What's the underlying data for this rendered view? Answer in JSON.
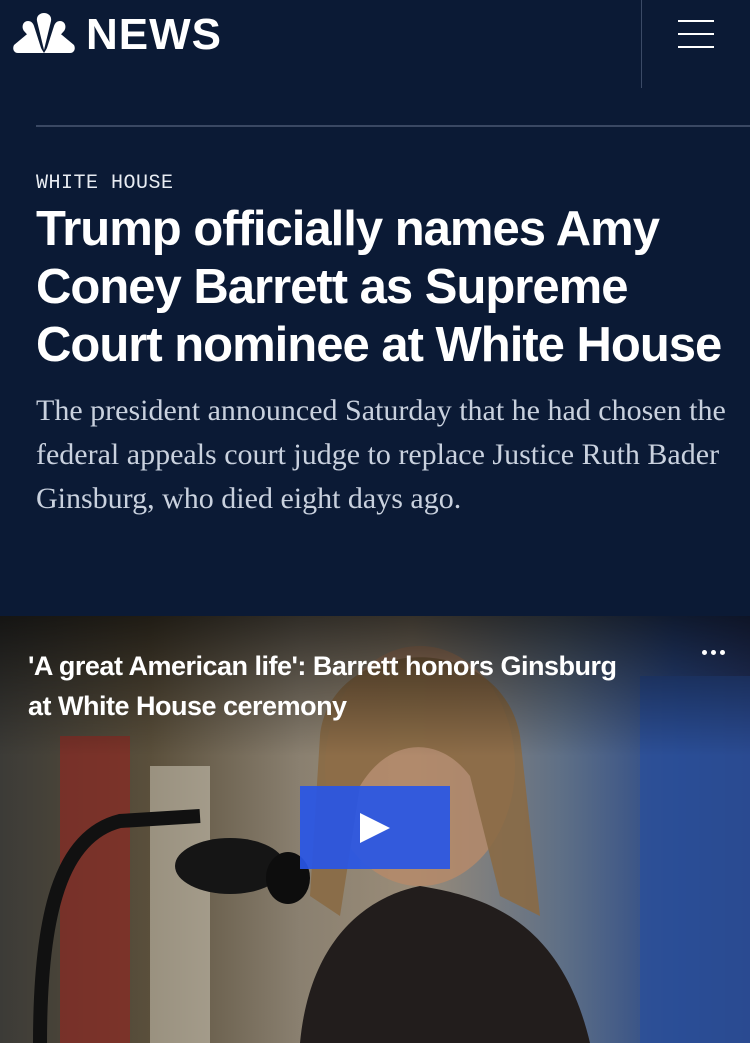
{
  "header": {
    "brand_text": "NEWS",
    "brand_logo_icon": "nbc-peacock-icon",
    "menu_icon": "hamburger-menu-icon"
  },
  "article": {
    "section_label": "WHITE HOUSE",
    "headline": "Trump officially names Amy Coney Barrett as Supreme Court nominee at White House",
    "dek": "The president announced Saturday that he had chosen the federal appeals court judge to replace Justice Ruth Bader Ginsburg, who died eight days ago."
  },
  "video": {
    "title": "'A great American life': Barrett honors Ginsburg at White House ceremony",
    "more_icon": "ellipsis-icon",
    "play_icon": "play-icon"
  },
  "colors": {
    "page_background": "#0b1a35",
    "play_button": "#2856e6",
    "dek_text": "#c9d1de"
  }
}
